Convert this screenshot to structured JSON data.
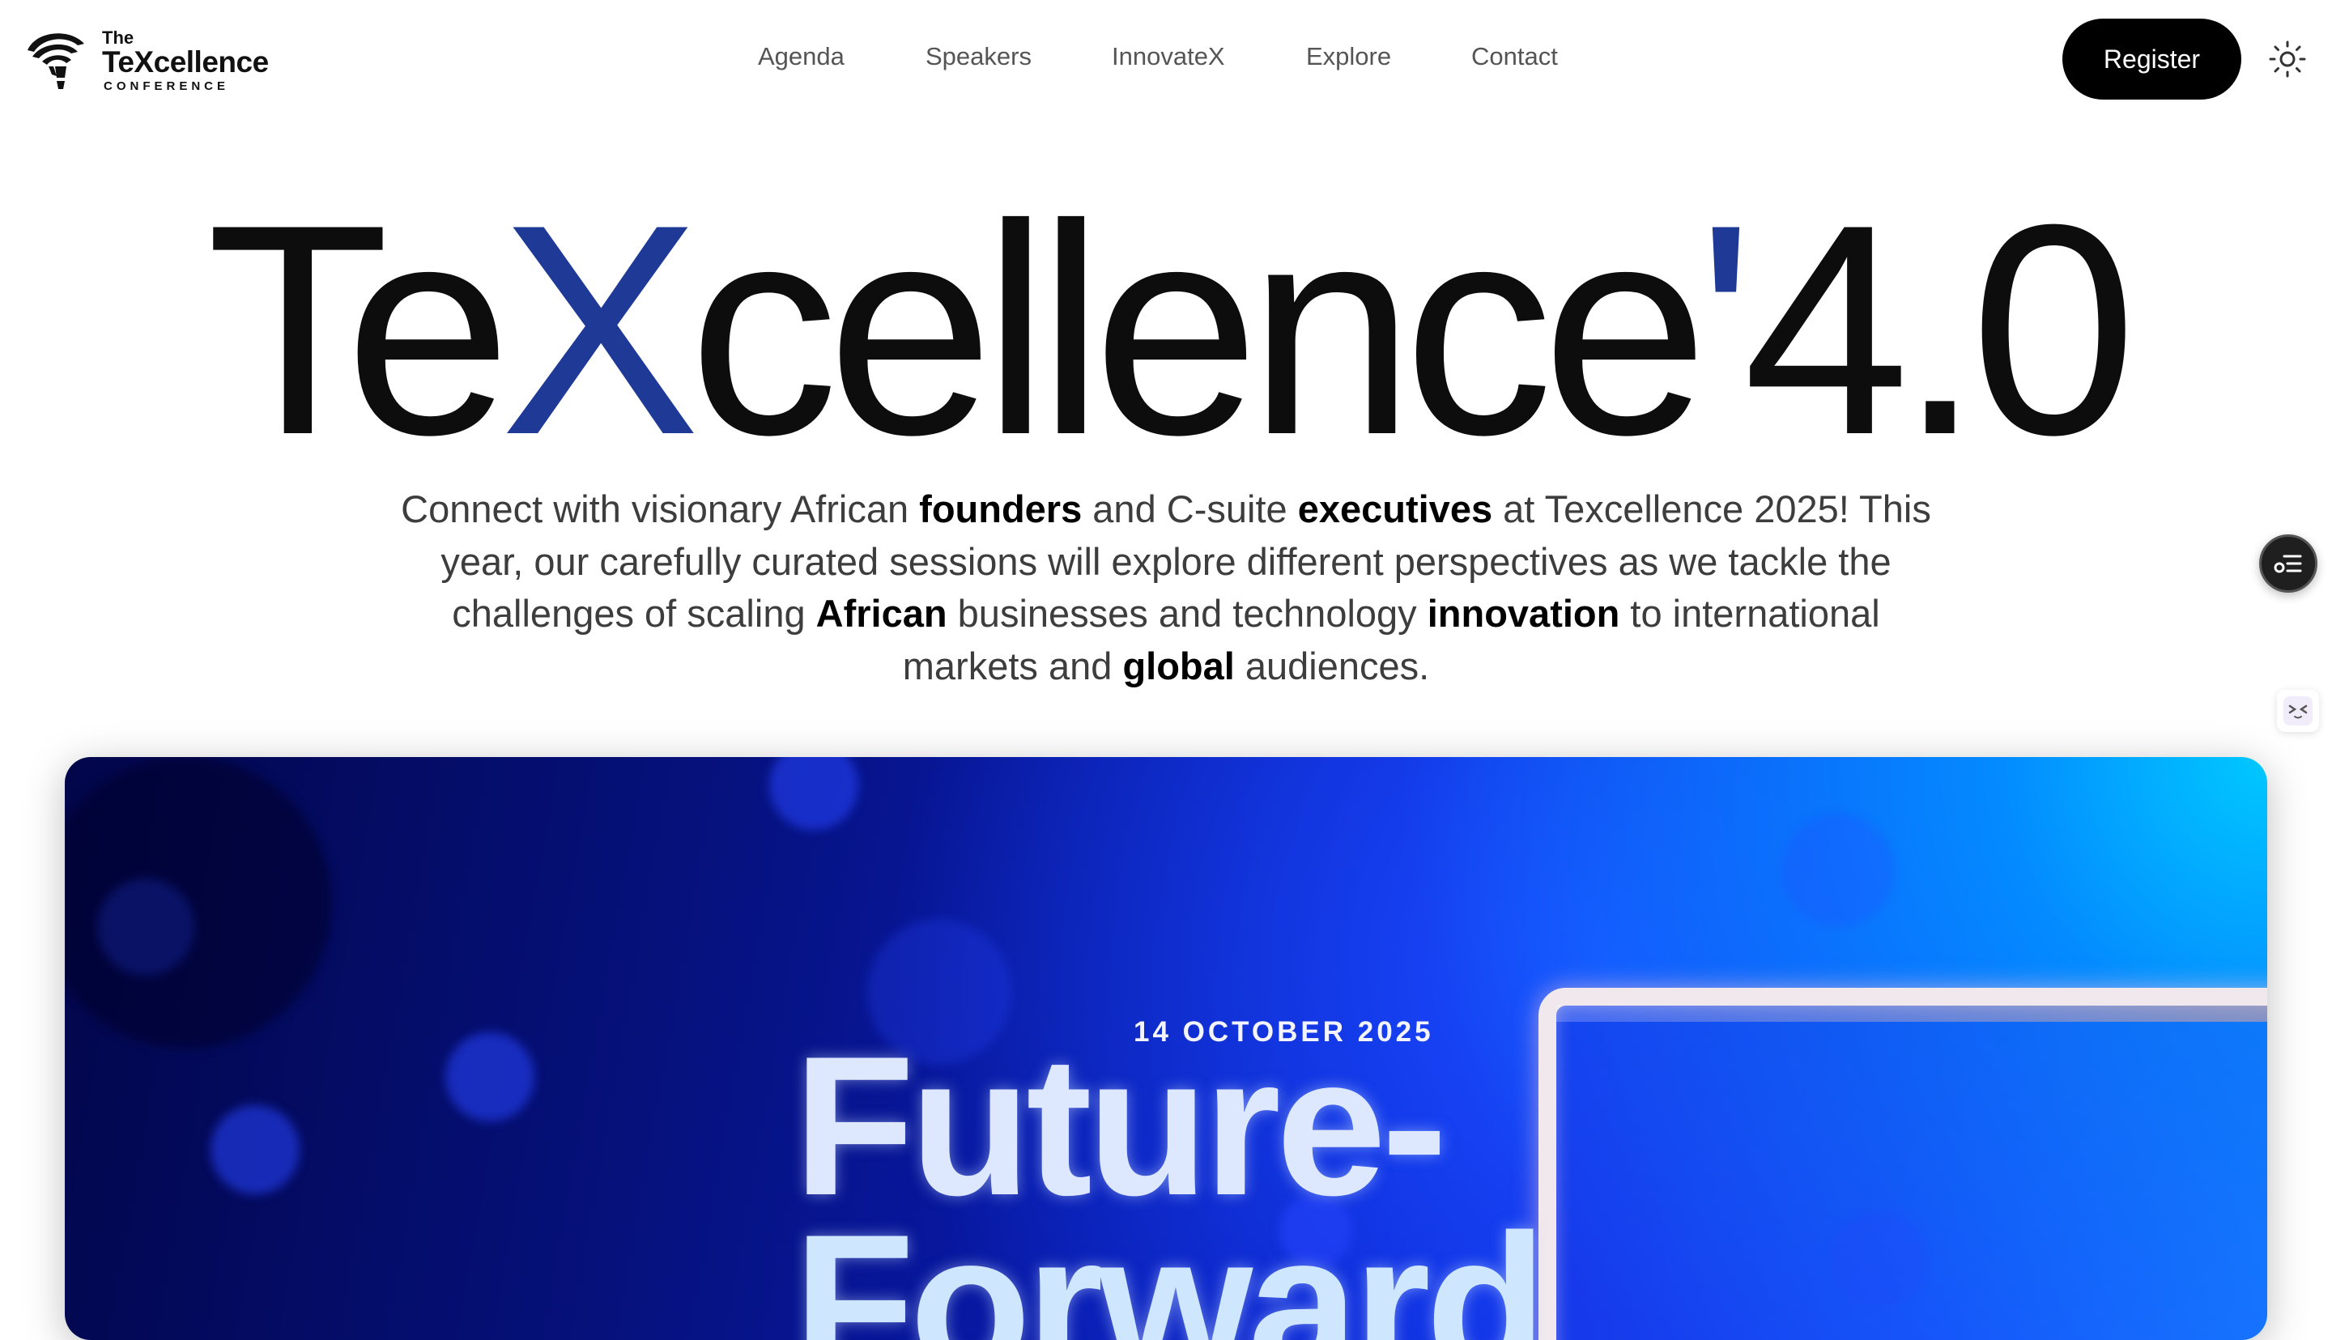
{
  "header": {
    "logo": {
      "the": "The",
      "brand": "TeXcellence",
      "tagline": "CONFERENCE"
    },
    "nav": [
      {
        "label": "Agenda"
      },
      {
        "label": "Speakers"
      },
      {
        "label": "InnovateX"
      },
      {
        "label": "Explore"
      },
      {
        "label": "Contact"
      }
    ],
    "register_label": "Register",
    "theme_icon": "sun-icon"
  },
  "hero": {
    "title_part1": "Te",
    "title_accent": "X",
    "title_part2": "cellence",
    "title_apostrophe": "'",
    "title_version": "4.0",
    "description": [
      {
        "text": "Connect with visionary African ",
        "bold": false
      },
      {
        "text": "founders",
        "bold": true
      },
      {
        "text": " and C-suite ",
        "bold": false
      },
      {
        "text": "executives",
        "bold": true
      },
      {
        "text": " at Texcellence 2025! This year, our carefully curated sessions will explore different perspectives as we tackle the challenges of scaling ",
        "bold": false
      },
      {
        "text": "African",
        "bold": true
      },
      {
        "text": " businesses and technology ",
        "bold": false
      },
      {
        "text": "innovation",
        "bold": true
      },
      {
        "text": " to international markets and ",
        "bold": false
      },
      {
        "text": "global",
        "bold": true
      },
      {
        "text": " audiences.",
        "bold": false
      }
    ]
  },
  "banner": {
    "date": "14 OCTOBER 2025",
    "headline_line1": "Future-",
    "headline_line2": "Forward"
  },
  "widgets": {
    "list_fab_icon": "list-settings-icon",
    "helper_icon": "assistant-face-icon"
  },
  "colors": {
    "accent": "#1e3a96",
    "register_bg": "#000000",
    "banner_blue": "#0a1fc9"
  }
}
